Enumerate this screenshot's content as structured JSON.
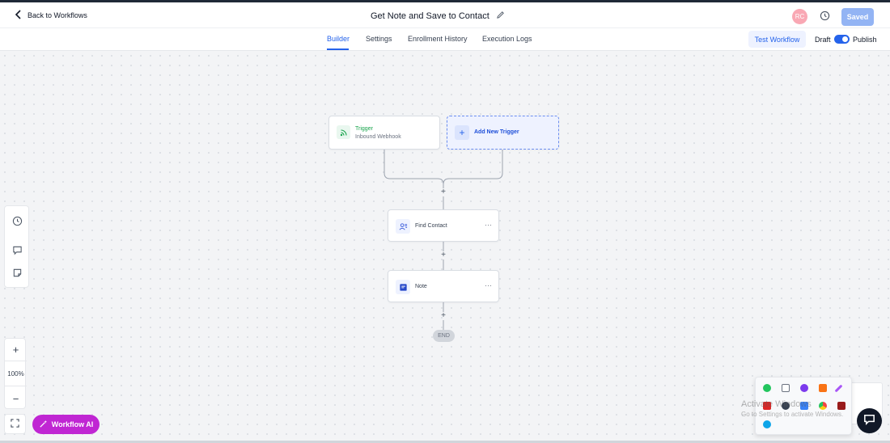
{
  "header": {
    "back_label": "Back to Workflows",
    "title": "Get Note and Save to Contact",
    "avatar_initials": "RC",
    "saved_label": "Saved"
  },
  "tabs": [
    {
      "label": "Builder",
      "active": true
    },
    {
      "label": "Settings",
      "active": false
    },
    {
      "label": "Enrollment History",
      "active": false
    },
    {
      "label": "Execution Logs",
      "active": false
    }
  ],
  "toolbar": {
    "test_label": "Test Workflow",
    "draft_label": "Draft",
    "publish_label": "Publish",
    "publish_toggle_on": true
  },
  "workflow": {
    "trigger": {
      "type_label": "Trigger",
      "name": "Inbound Webhook"
    },
    "add_trigger_label": "Add New Trigger",
    "actions": [
      {
        "label": "Find Contact",
        "icon": "user-search-icon"
      },
      {
        "label": "Note",
        "icon": "note-icon"
      }
    ],
    "end_label": "END",
    "connector_plus": "+"
  },
  "canvas_controls": {
    "zoom_in": "+",
    "zoom_level": "100%",
    "zoom_out": "−",
    "ai_label": "Workflow AI"
  },
  "overlay": {
    "watermark_title": "Activate Windows",
    "watermark_sub": "Go to Settings to activate Windows."
  },
  "colors": {
    "accent": "#2563eb",
    "saved_button": "#93b4f4",
    "ai_button": "#c026d3",
    "trigger_green": "#16a34a"
  }
}
